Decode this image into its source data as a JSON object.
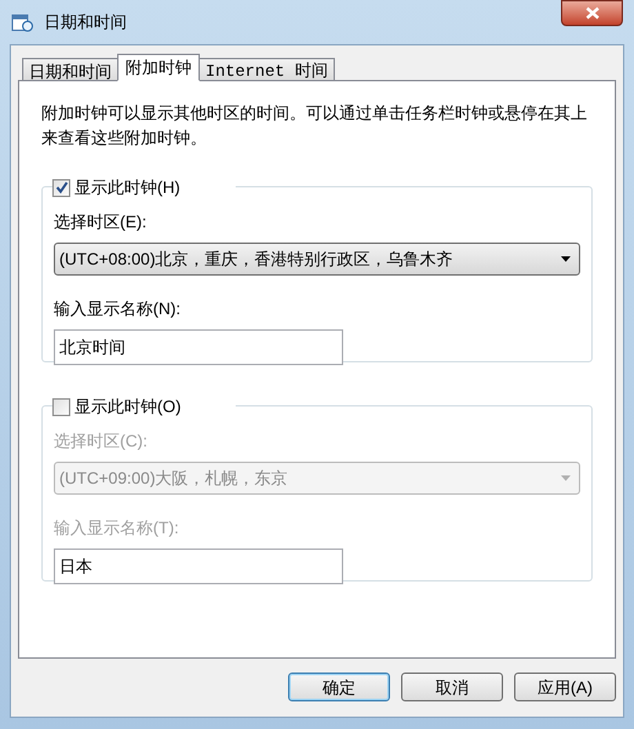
{
  "window": {
    "title": "日期和时间"
  },
  "tabs": [
    {
      "label": "日期和时间",
      "selected": false
    },
    {
      "label": "附加时钟",
      "selected": true
    },
    {
      "label": "Internet 时间",
      "selected": false
    }
  ],
  "description": "附加时钟可以显示其他时区的时间。可以通过单击任务栏时钟或悬停在其上来查看这些附加时钟。",
  "clocks": [
    {
      "checkbox_label": "显示此时钟(H)",
      "checked": true,
      "timezone_label": "选择时区(E):",
      "timezone": "(UTC+08:00)北京，重庆，香港特别行政区，乌鲁木齐",
      "name_label": "输入显示名称(N):",
      "name": "北京时间"
    },
    {
      "checkbox_label": "显示此时钟(O)",
      "checked": false,
      "timezone_label": "选择时区(C):",
      "timezone": "(UTC+09:00)大阪，札幌，东京",
      "name_label": "输入显示名称(T):",
      "name": "日本"
    }
  ],
  "buttons": [
    {
      "label": "确定",
      "default": true
    },
    {
      "label": "取消",
      "default": false
    },
    {
      "label": "应用(A)",
      "default": false
    }
  ]
}
